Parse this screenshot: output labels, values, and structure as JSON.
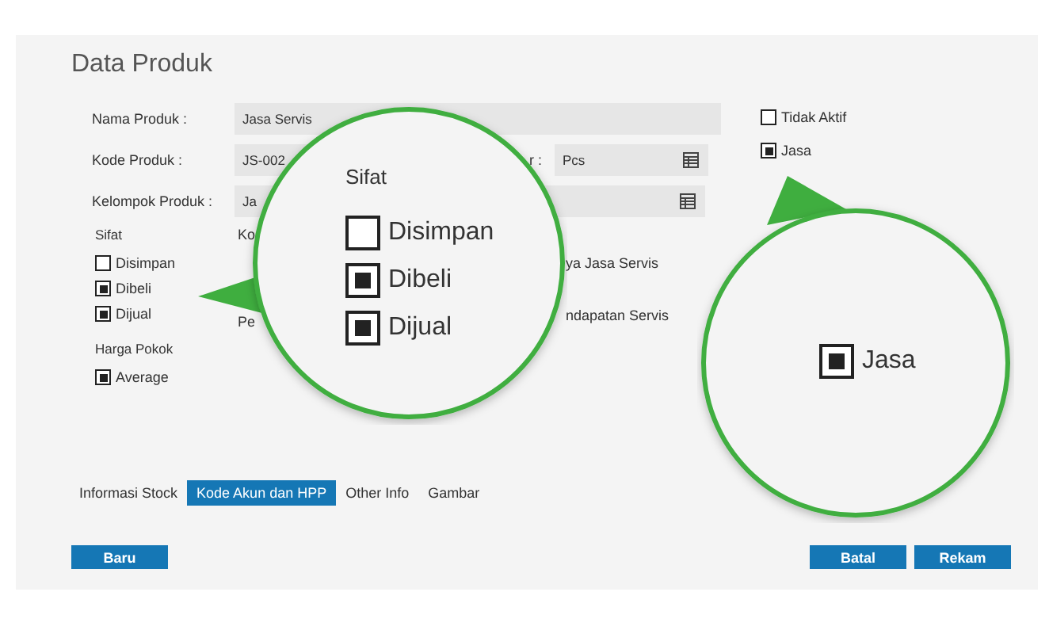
{
  "title": "Data Produk",
  "fields": [
    {
      "label": "Nama Produk :",
      "value": "Jasa Servis",
      "lookup": false
    },
    {
      "label": "Kode Produk :",
      "value": "JS-002",
      "lookup": false,
      "side_label": "r :",
      "side_value": "Pcs",
      "side_lookup": true
    },
    {
      "label": "Kelompok Produk :",
      "value": "Ja",
      "lookup": true
    }
  ],
  "flags": [
    {
      "label": "Tidak Aktif",
      "checked": false
    },
    {
      "label": "Jasa",
      "checked": true
    }
  ],
  "sifat": {
    "label": "Sifat",
    "options": [
      {
        "label": "Disimpan",
        "checked": false
      },
      {
        "label": "Dibeli",
        "checked": true
      },
      {
        "label": "Dijual",
        "checked": true
      }
    ]
  },
  "harga_pokok": {
    "label": "Harga Pokok",
    "options": [
      {
        "label": "Average",
        "checked": true
      }
    ]
  },
  "column_2": [
    "Ko",
    "Pe"
  ],
  "column_3": [
    "ya Jasa Servis",
    "ndapatan Servis"
  ],
  "tabs": [
    {
      "label": "Informasi Stock",
      "selected": false
    },
    {
      "label": "Kode Akun dan HPP",
      "selected": true
    },
    {
      "label": "Other Info",
      "selected": false
    },
    {
      "label": "Gambar",
      "selected": false
    }
  ],
  "buttons_left": [
    "Baru"
  ],
  "buttons_right": [
    "Batal",
    "Rekam"
  ],
  "callouts": [
    {
      "kind": "left",
      "heading": "Sifat",
      "options": [
        {
          "label": "Disimpan",
          "checked": false
        },
        {
          "label": "Dibeli",
          "checked": true
        },
        {
          "label": "Dijual",
          "checked": true
        }
      ]
    },
    {
      "kind": "up",
      "options": [
        {
          "label": "Jasa",
          "checked": true
        }
      ]
    }
  ]
}
